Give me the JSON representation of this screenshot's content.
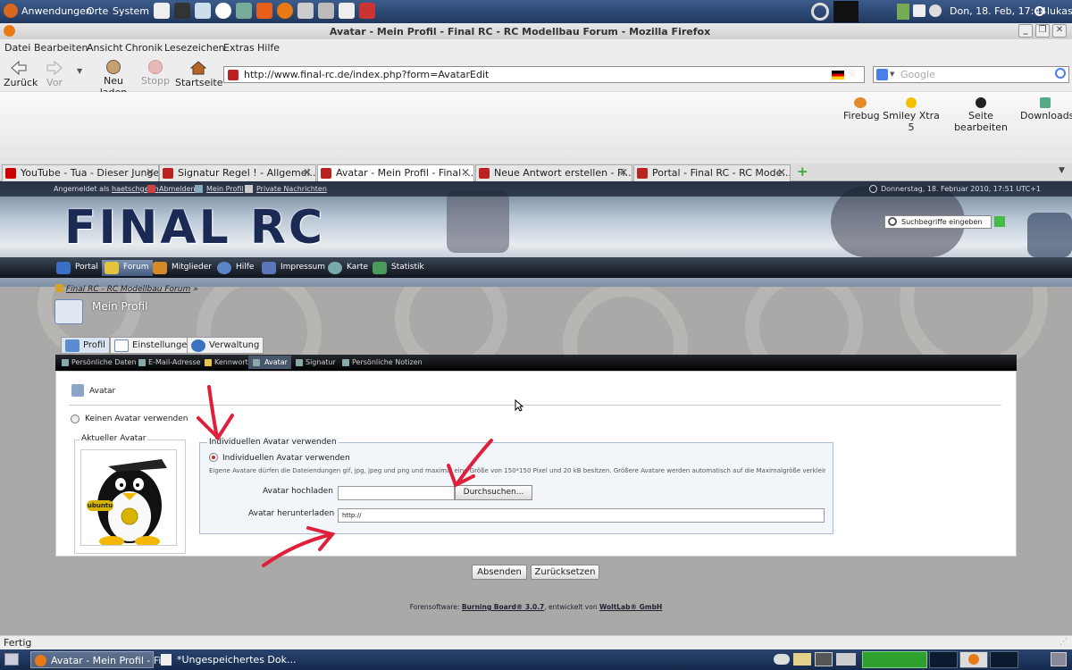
{
  "gnome_top": {
    "menus": [
      "Anwendungen",
      "Orte",
      "System"
    ],
    "clock": "Don, 18. Feb, 17:44",
    "user": "lukas"
  },
  "window": {
    "title": "Avatar - Mein Profil - Final RC - RC Modellbau Forum - Mozilla Firefox"
  },
  "menubar": [
    "Datei",
    "Bearbeiten",
    "Ansicht",
    "Chronik",
    "Lesezeichen",
    "Extras",
    "Hilfe"
  ],
  "nav": {
    "back": "Zurück",
    "forward": "Vor",
    "reload": "Neu laden",
    "stop": "Stopp",
    "home": "Startseite"
  },
  "url": "http://www.final-rc.de/index.php?form=AvatarEdit",
  "search_placeholder": "Google",
  "toolbar2": [
    "Firebug",
    "Smiley Xtra 5",
    "Seite bearbeiten",
    "Downloads"
  ],
  "tabs": [
    "YouTube - Tua - Dieser Junge",
    "Signatur Regel ! - Allgemei...",
    "Avatar - Mein Profil - Final ...",
    "Neue Antwort erstellen - Fi...",
    "Portal - Final RC - RC Mode..."
  ],
  "forum": {
    "logged_in_prefix": "Angemeldet als",
    "username": "haetschgerm",
    "logout": "Abmelden",
    "my_profile": "Mein Profil",
    "pm": "Private Nachrichten",
    "datetime": "Donnerstag, 18. Februar 2010, 17:51 UTC+1",
    "logo": "FINAL RC",
    "search_placeholder": "Suchbegriffe eingeben",
    "mainnav": [
      "Portal",
      "Forum",
      "Mitglieder",
      "Hilfe",
      "Impressum",
      "Karte",
      "Statistik"
    ],
    "breadcrumb": "Final RC - RC Modellbau Forum",
    "breadcrumb_sep": "»",
    "page_title": "Mein Profil",
    "profile_tabs": [
      "Profil",
      "Einstellungen",
      "Verwaltung"
    ],
    "subnav": [
      "Persönliche Daten",
      "E-Mail-Adresse",
      "Kennwort",
      "Avatar",
      "Signatur",
      "Persönliche Notizen"
    ],
    "section_title": "Avatar",
    "no_avatar": "Keinen Avatar verwenden",
    "current_avatar": "Aktueller Avatar",
    "avatar_text": "ubuntu",
    "indiv_legend": "Individuellen Avatar verwenden",
    "indiv_option": "Individuellen Avatar verwenden",
    "hint": "Eigene Avatare dürfen die Dateiendungen gif, jpg, jpeg und png und maximal eine Größe von 150*150 Pixel und 20 kB besitzen. Größere Avatare werden automatisch auf die Maximalgröße verkleinert.",
    "upload_label": "Avatar hochladen",
    "browse": "Durchsuchen...",
    "download_label": "Avatar herunterladen",
    "download_value": "http://",
    "submit": "Absenden",
    "reset": "Zurücksetzen",
    "footer_prefix": "Forensoftware:",
    "footer_product": "Burning Board® 3.0.7",
    "footer_mid": ", entwickelt von",
    "footer_vendor": "WoltLab® GmbH"
  },
  "statusbar": "Fertig",
  "taskbar": [
    "Avatar - Mein Profil - Fi...",
    "*Ungespeichertes Dok..."
  ],
  "colors": {
    "annotation_red": "#e0203a",
    "accent_blue": "#1f3a6a"
  }
}
